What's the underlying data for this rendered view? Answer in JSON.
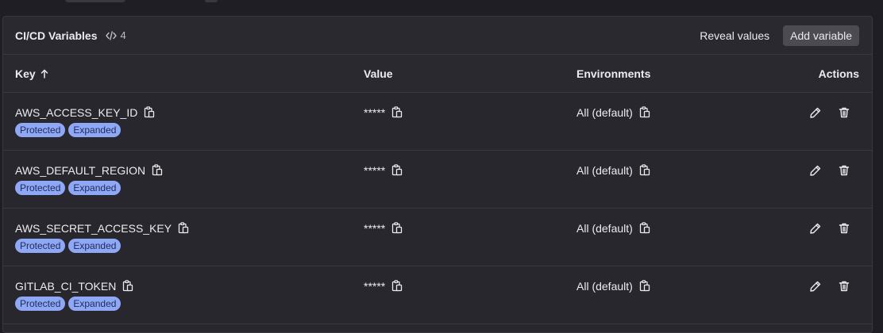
{
  "card": {
    "title": "CI/CD Variables",
    "count": "4",
    "reveal_label": "Reveal values",
    "add_label": "Add variable"
  },
  "columns": {
    "key": "Key",
    "value": "Value",
    "environments": "Environments",
    "actions": "Actions"
  },
  "rows": [
    {
      "key": "AWS_ACCESS_KEY_ID",
      "value": "*****",
      "env": "All (default)",
      "badges": [
        "Protected",
        "Expanded"
      ]
    },
    {
      "key": "AWS_DEFAULT_REGION",
      "value": "*****",
      "env": "All (default)",
      "badges": [
        "Protected",
        "Expanded"
      ]
    },
    {
      "key": "AWS_SECRET_ACCESS_KEY",
      "value": "*****",
      "env": "All (default)",
      "badges": [
        "Protected",
        "Expanded"
      ]
    },
    {
      "key": "GITLAB_CI_TOKEN",
      "value": "*****",
      "env": "All (default)",
      "badges": [
        "Protected",
        "Expanded"
      ]
    }
  ],
  "icons": {
    "count": "code-icon",
    "sort": "arrow-up-icon",
    "copy": "clipboard-icon",
    "edit": "pencil-icon",
    "delete": "trash-icon"
  },
  "colors": {
    "badge_bg": "#8fa8f5",
    "badge_text": "#1f2a59",
    "page_bg": "#1f1e24",
    "card_bg": "#28272d"
  }
}
